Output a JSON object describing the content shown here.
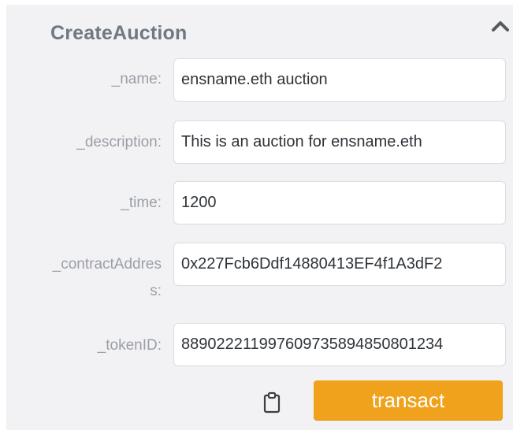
{
  "function": {
    "title": "CreateAuction"
  },
  "fields": [
    {
      "label": "_name:",
      "value": "ensname.eth auction"
    },
    {
      "label": "_description:",
      "value": "This is an auction for ensname.eth"
    },
    {
      "label": "_time:",
      "value": "1200"
    },
    {
      "label_line1": "_contractAddres",
      "label_line2": "s:",
      "value": "0x227Fcb6Ddf14880413EF4f1A3dF2"
    },
    {
      "label": "_tokenID:",
      "value": "889022211997609735894850801234"
    }
  ],
  "actions": {
    "transact_label": "transact"
  },
  "icons": {
    "collapse": "chevron-up-icon",
    "copy": "clipboard-icon"
  },
  "colors": {
    "transact_button": "#f0a21c",
    "panel_background": "#f2f2f5"
  }
}
